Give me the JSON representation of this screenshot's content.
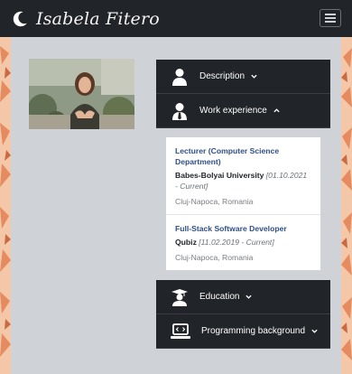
{
  "brand": {
    "title": "Isabela Fitero",
    "icon": "moon-icon"
  },
  "navbar": {
    "toggler_icon": "hamburger-icon"
  },
  "photo": {
    "alt": "Profile photo"
  },
  "accordion": {
    "description": {
      "label": "Description",
      "icon": "person-icon",
      "expanded": false
    },
    "work": {
      "label": "Work experience",
      "icon": "person-tie-icon",
      "expanded": true,
      "items": [
        {
          "title": "Lecturer (Computer Science Department)",
          "org": "Babes-Bolyai University",
          "dates": "[01.10.2021 - Current]",
          "location": "Cluj-Napoca, Romania"
        },
        {
          "title": "Full-Stack Software Developer",
          "org": "Qubiz",
          "dates": "[11.02.2019 - Current]",
          "location": "Cluj-Napoca, Romania"
        }
      ]
    },
    "education": {
      "label": "Education",
      "icon": "graduation-cap-icon",
      "expanded": false
    },
    "programming": {
      "label": "Programming background",
      "icon": "laptop-code-icon",
      "expanded": false
    }
  },
  "colors": {
    "navbar": "#212428",
    "panel": "#cfd3d8",
    "accent_link": "#2f4f86",
    "leaf_pattern": "#e9a07a"
  }
}
